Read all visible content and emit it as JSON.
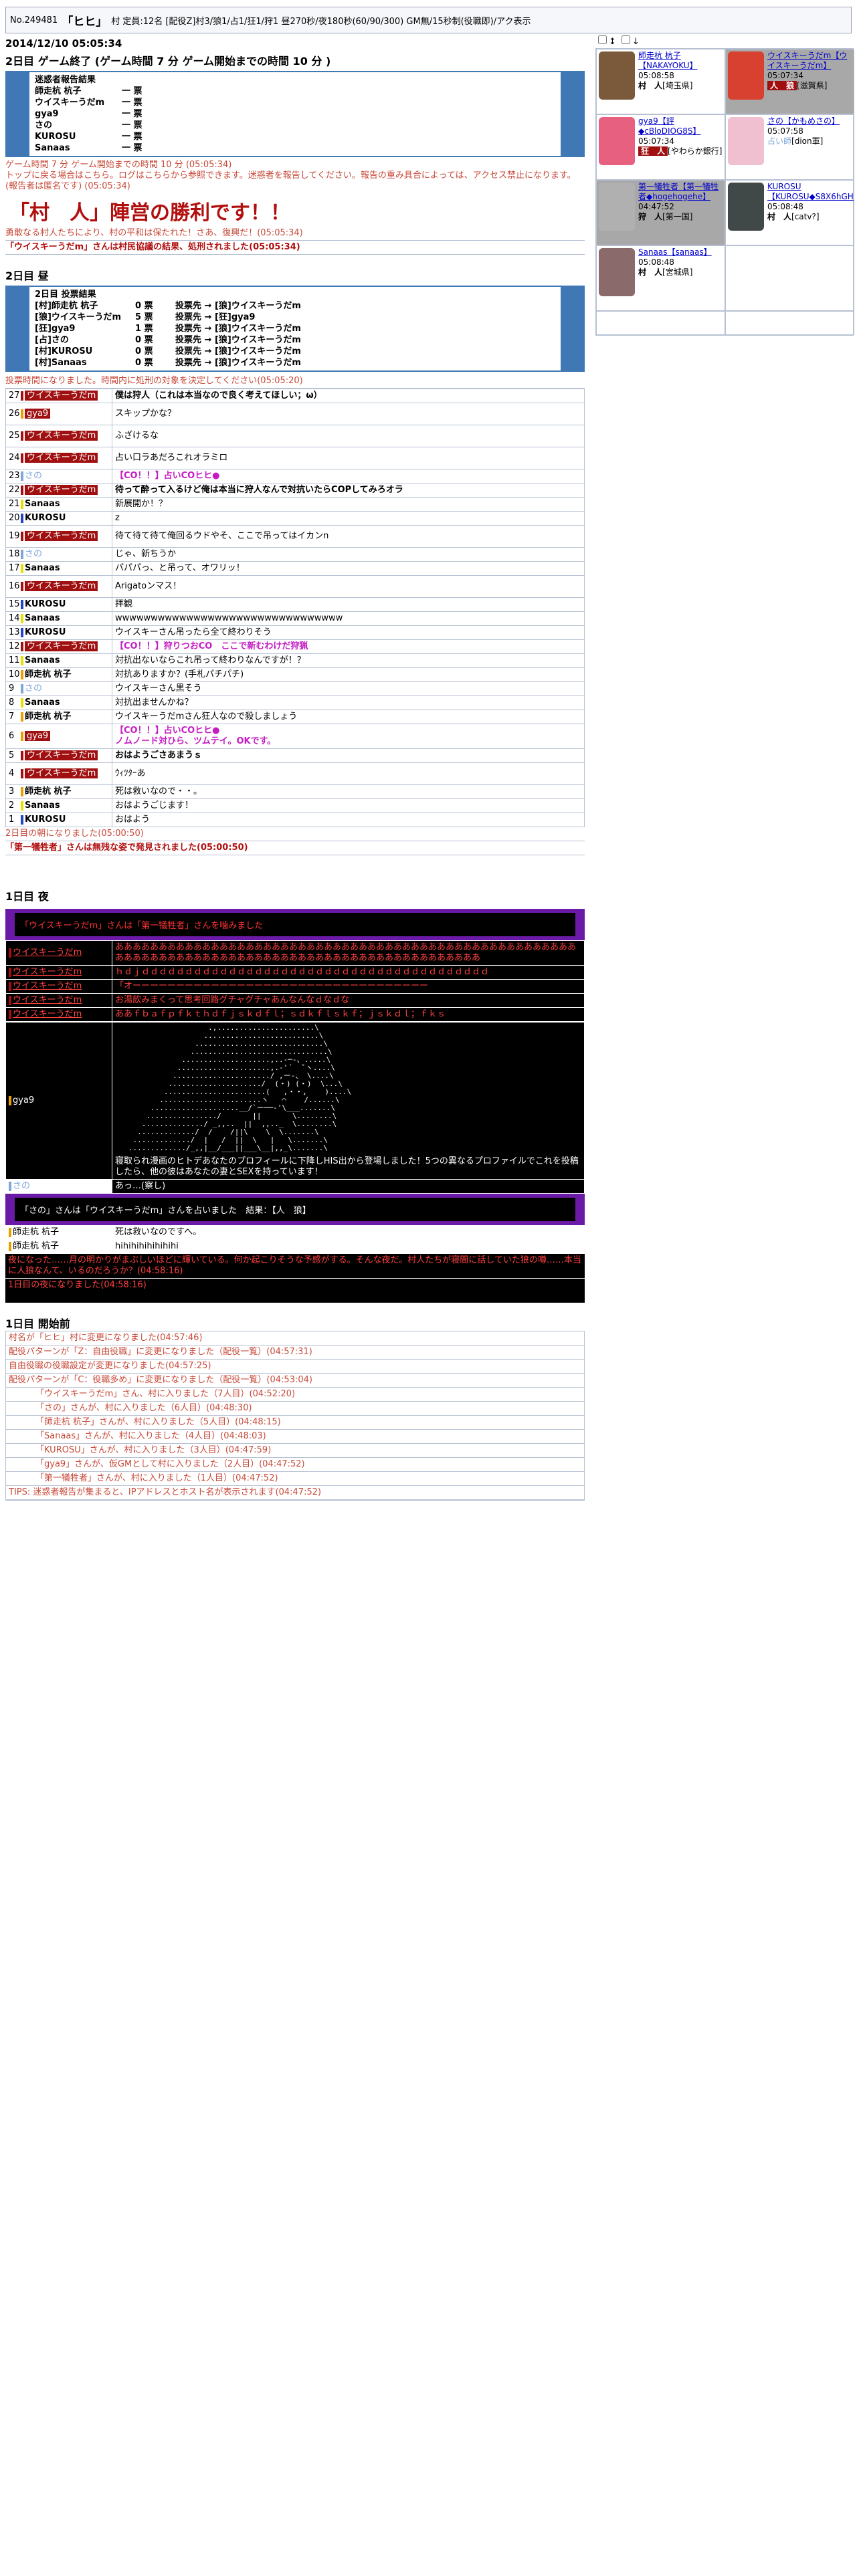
{
  "header": {
    "no": "No.249481",
    "village": "「ヒヒ」",
    "tail": "村  定員:12名 [配役Z]村3/狼1/占1/狂1/狩1  昼270秒/夜180秒(60/90/300)  GM無/15秒制(役職即)/アク表示"
  },
  "right_controls": {
    "a": "↕",
    "b": "↓"
  },
  "endtime": "2014/12/10 05:05:34",
  "day2_end_title": "2日目 ゲーム終了 (ゲーム時間 7 分  ゲーム開始までの時間 10 分 )",
  "nuisance": {
    "title": "迷惑者報告結果",
    "rows": [
      {
        "n": "師走杭 杭子",
        "v": "一 票"
      },
      {
        "n": "ウイスキーうだm",
        "v": "一 票"
      },
      {
        "n": "gya9",
        "v": "一 票"
      },
      {
        "n": "さの",
        "v": "一 票"
      },
      {
        "n": "KUROSU",
        "v": "一 票"
      },
      {
        "n": "Sanaas",
        "v": "一 票"
      }
    ]
  },
  "sys1": "ゲーム時間 7 分  ゲーム開始までの時間 10 分 (05:05:34)",
  "sys2": "トップに戻る場合はこちら。ログはこちらから参照できます。迷惑者を報告してください。報告の重み具合によっては、アクセス禁止になります。(報告者は匿名です) (05:05:34)",
  "win": "「村　人」陣営の勝利です！！",
  "sys3": "勇敢なる村人たちにより、村の平和は保たれた！さあ、復興だ！(05:05:34)",
  "exec1": "「ウイスキーうだm」さんは村民協議の結果、処刑されました(05:05:34)",
  "day2_title": "2日目 昼",
  "vote": {
    "title": "2日目  投票結果",
    "rows": [
      {
        "n": "[村]師走杭 杭子",
        "v": "0 票",
        "t": "投票先 → [狼]ウイスキーうだm"
      },
      {
        "n": "[狼]ウイスキーうだm",
        "v": "5 票",
        "t": "投票先 → [狂]gya9"
      },
      {
        "n": "[狂]gya9",
        "v": "1 票",
        "t": "投票先 → [狼]ウイスキーうだm"
      },
      {
        "n": "[占]さの",
        "v": "0 票",
        "t": "投票先 → [狼]ウイスキーうだm"
      },
      {
        "n": "[村]KUROSU",
        "v": "0 票",
        "t": "投票先 → [狼]ウイスキーうだm"
      },
      {
        "n": "[村]Sanaas",
        "v": "0 票",
        "t": "投票先 → [狼]ウイスキーうだm"
      }
    ]
  },
  "sys4": "投票時間になりました。時間内に処刑の対象を決定してください(05:05:20)",
  "day2_log": [
    {
      "i": "27",
      "n": "ウイスキーうだm",
      "c": "#a01010",
      "w": true,
      "t": "僕は狩人（これは本当なので良く考えてほしい；ω）",
      "s": "big"
    },
    {
      "i": "26",
      "n": "gya9",
      "c": "#e8a000",
      "w": true,
      "t": "スキップかな？"
    },
    {
      "i": "25",
      "n": "ウイスキーうだm",
      "c": "#a01010",
      "w": true,
      "t": "ふざけるな"
    },
    {
      "i": "24",
      "n": "ウイスキーうだm",
      "c": "#a01010",
      "w": true,
      "t": "占い口ラあだろこれオラミロ"
    },
    {
      "i": "23",
      "n": "さの",
      "c": "#7fa6d9",
      "w": false,
      "t": "【CO！！】占いCOヒヒ●",
      "s": "co"
    },
    {
      "i": "22",
      "n": "ウイスキーうだm",
      "c": "#a01010",
      "w": true,
      "t": "待って酔って入るけど俺は本当に狩人なんで対抗いたらCOPしてみろオラ",
      "s": "big"
    },
    {
      "i": "21",
      "n": "Sanaas",
      "c": "#e8e000",
      "w": false,
      "t": "新展開か！？"
    },
    {
      "i": "20",
      "n": "KUROSU",
      "c": "#2244cc",
      "w": false,
      "t": "z"
    },
    {
      "i": "19",
      "n": "ウイスキーうだm",
      "c": "#a01010",
      "w": true,
      "t": "待て待て待て俺回るウドやそ、ここで吊ってはイカンn"
    },
    {
      "i": "18",
      "n": "さの",
      "c": "#7fa6d9",
      "w": false,
      "t": "じゃ、新ちうか"
    },
    {
      "i": "17",
      "n": "Sanaas",
      "c": "#e8e000",
      "w": false,
      "t": "パパパっ、と吊って、オワリッ！"
    },
    {
      "i": "16",
      "n": "ウイスキーうだm",
      "c": "#a01010",
      "w": true,
      "t": "Arigatoンマス！"
    },
    {
      "i": "15",
      "n": "KUROSU",
      "c": "#2244cc",
      "w": false,
      "t": "拝観"
    },
    {
      "i": "14",
      "n": "Sanaas",
      "c": "#e8e000",
      "w": false,
      "t": "wwwwwwwwwwwwwwwwwwwwwwwwwwwwwwww"
    },
    {
      "i": "13",
      "n": "KUROSU",
      "c": "#2244cc",
      "w": false,
      "t": "ウイスキーさん吊ったら全て終わりそう"
    },
    {
      "i": "12",
      "n": "ウイスキーうだm",
      "c": "#a01010",
      "w": true,
      "t": "【CO！！】狩りつおCO　ここで新むわけだ狩猟",
      "s": "co"
    },
    {
      "i": "11",
      "n": "Sanaas",
      "c": "#e8e000",
      "w": false,
      "t": "対抗出ないならこれ吊って終わりなんですが！？"
    },
    {
      "i": "10",
      "n": "師走杭 杭子",
      "c": "#e8a000",
      "w": false,
      "t": "対抗ありますか？(手札パチパチ)"
    },
    {
      "i": "9",
      "n": "さの",
      "c": "#7fa6d9",
      "w": false,
      "t": "ウイスキーさん黒そう"
    },
    {
      "i": "8",
      "n": "Sanaas",
      "c": "#e8e000",
      "w": false,
      "t": "対抗出ませんかね？"
    },
    {
      "i": "7",
      "n": "師走杭 杭子",
      "c": "#e8a000",
      "w": false,
      "t": "ウイスキーうだmさん狂人なので殺しましょう"
    },
    {
      "i": "6",
      "n": "gya9",
      "c": "#e8a000",
      "w": true,
      "t": "【CO！！】占いCOヒヒ●\nノムノード対ひら、ツムテイ。OKです。",
      "s": "co"
    },
    {
      "i": "5",
      "n": "ウイスキーうだm",
      "c": "#a01010",
      "w": true,
      "t": "おはようごさあまうｓ",
      "s": "big"
    },
    {
      "i": "4",
      "n": "ウイスキーうだm",
      "c": "#a01010",
      "w": true,
      "t": "ｳｨﾂﾀｰあ"
    },
    {
      "i": "3",
      "n": "師走杭 杭子",
      "c": "#e8a000",
      "w": false,
      "t": "死は救いなので・・。"
    },
    {
      "i": "2",
      "n": "Sanaas",
      "c": "#e8e000",
      "w": false,
      "t": "おはようごじます！"
    },
    {
      "i": "1",
      "n": "KUROSU",
      "c": "#2244cc",
      "w": false,
      "t": "おはよう"
    }
  ],
  "sys5": "2日目の朝になりました(05:00:50)",
  "sys6": "「第一犠牲者」さんは無残な姿で発見されました(05:00:50)",
  "night_title": "1日目 夜",
  "night_kill": "「ウイスキーうだm」さんは「第一犠牲者」さんを噛みました",
  "night_log": [
    {
      "n": "ウイスキーうだm",
      "t": "あああああああああああああああああああああああああああああああああああああああああああああああああああああああああああああああああああああああああああああああああああああああああああああああ"
    },
    {
      "n": "ウイスキーうだm",
      "t": "ｈｄｊｄｄｄｄｄｄｄｄｄｄｄｄｄｄｄｄｄｄｄｄｄｄｄｄｄｄｄｄｄｄｄｄｄｄｄｄｄｄｄｄ"
    },
    {
      "n": "ウイスキーうだm",
      "t": "「オーーーーーーーーーーーーーーーーーーーーーーーーーーーーーーーーーー"
    },
    {
      "n": "ウイスキーうだm",
      "t": "お湯飲みまくって思考回路グチャグチャあんなんなｄなｄな"
    },
    {
      "n": "ウイスキーうだm",
      "t": "ああｆｂａｆｐｆｋｔｈｄｆｊｓｋｄｆｌ；ｓｄｋｆｌｓｋｆ；ｊｓｋｄｌ；ｆｋｓ"
    }
  ],
  "aa_text": "寝取られ漫画のヒトデあなたのプロフィールに下降しHIS出から登場しました！5つの異なるプロファイルでこれを投稿したら、他の彼はあなたの妻とSEXを持っています！",
  "aa_art": "                     .,......................\\\n                    ..........................\\\n                  .............................\\\n                 ...............................\\\n               ....................,..-─-、.....\\\n              .....................,.-'´  ̄`ヽ....\\\n             ....................../ ,ー-、 \\....\\\n            ...................../  (・) (・)  \\...\\\n           .......................(   ,・・,    )....\\\n          .......................ヽ   ⌒    /......\\\n        ....................__/`ー──‐'\\___.......\\\n       ................/       ||       \\........\\\n      ............../ _,,..  ||  ,,.._  \\........\\\n     ............./  /    /||\\    \\  \\.......\\\n    ............./  |   /  ||  \\   |   \\.......\\\n   ............./_,,|__/___||___\\__|,,_\\.......\\",
  "saki_aa": "あっ…(察し)",
  "div_banner": "「さの」さんは「ウイスキーうだm」さんを占いました　結果：【人　狼】",
  "kuiko_lines": [
    "死は救いなのですへ。",
    "hihihihihihihihi"
  ],
  "kuiko_name": "師走杭 杭子",
  "sys7": "夜になった……月の明かりがまぶしいほどに輝いている。何か起こりそうな予感がする。そんな夜だ。村人たちが寝間に話していた狼の噂……本当に人狼なんて、いるのだろうか？(04:58:16)",
  "sys8": "1日目の夜になりました(04:58:16)",
  "pre_title": "1日目 開始前",
  "pre_log": [
    {
      "t": "村名が「ヒヒ」村に変更になりました(04:57:46)",
      "i": false
    },
    {
      "t": "配役パターンが「Z：自由役職」に変更になりました（配役一覧）(04:57:31)",
      "i": false
    },
    {
      "t": "自由役職の役職設定が変更になりました(04:57:25)",
      "i": false
    },
    {
      "t": "配役パターンが「C：役職多め」に変更になりました（配役一覧）(04:53:04)",
      "i": false
    },
    {
      "t": "「ウイスキーうだm」さん、村に入りました（7人目）(04:52:20)",
      "i": true
    },
    {
      "t": "「さの」さんが、村に入りました（6人目）(04:48:30)",
      "i": true
    },
    {
      "t": "「師走杭 杭子」さんが、村に入りました（5人目）(04:48:15)",
      "i": true
    },
    {
      "t": "「Sanaas」さんが、村に入りました（4人目）(04:48:03)",
      "i": true
    },
    {
      "t": "「KUROSU」さんが、村に入りました（3人目）(04:47:59)",
      "i": true
    },
    {
      "t": "「gya9」さんが、仮GMとして村に入りました（2人目）(04:47:52)",
      "i": true
    },
    {
      "t": "「第一犠牲者」さんが、村に入りました（1人目）(04:47:52)",
      "i": true
    },
    {
      "t": "TIPS: 迷惑者報告が集まると、IPアドレスとホスト名が表示されます(04:47:52)",
      "i": false
    }
  ],
  "players": [
    {
      "name": "師走杭 杭子【NAKAYOKU】",
      "time": "05:08:58",
      "role": "村　人",
      "pref": "[埼玉県]",
      "dead": false,
      "av": "#7a5a3a",
      "rc": "vil"
    },
    {
      "name": "ウイスキーうだm【ウイスキーうだm】",
      "time": "05:07:34",
      "role": "人　狼",
      "pref": "[滋賀県]",
      "dead": true,
      "av": "#d84030",
      "rc": "wolf"
    },
    {
      "name": "gya9【評◆cBloDIOG8S】",
      "time": "05:07:34",
      "role": "狂　人",
      "pref": "[やわらか銀行]",
      "dead": false,
      "av": "#e86080",
      "rc": "wolf"
    },
    {
      "name": "さの【かもめさの】",
      "time": "05:07:58",
      "role": "占い師",
      "pref": "[dion軍]",
      "dead": false,
      "av": "#f0c0d0",
      "rc": "saki"
    },
    {
      "name": "第一犠牲者【第一犠牲者◆hogehogehe】",
      "time": "04:47:52",
      "role": "狩　人",
      "pref": "[第一国]",
      "dead": true,
      "av": "#b0b0b0",
      "rc": "vil"
    },
    {
      "name": "KUROSU【KUROSU◆S8X6hGHa5A】",
      "time": "05:08:48",
      "role": "村　人",
      "pref": "[catv?]",
      "dead": false,
      "av": "#404848",
      "rc": "vil"
    },
    {
      "name": "Sanaas【sanaas】",
      "time": "05:08:48",
      "role": "村　人",
      "pref": "[宮城県]",
      "dead": false,
      "av": "#8a6a6a",
      "rc": "vil"
    }
  ]
}
